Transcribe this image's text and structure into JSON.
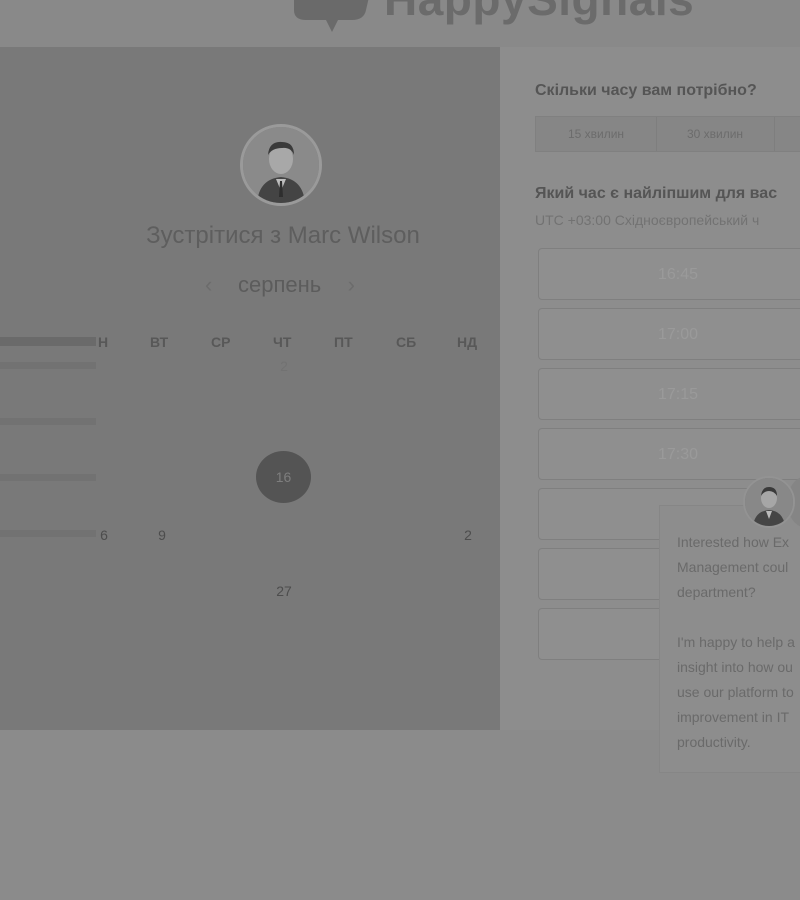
{
  "brand": {
    "logo_text": "HappySignals"
  },
  "calendar": {
    "host_title": "Зустрітися з Marc Wilson",
    "month": "серпень",
    "prev_icon": "‹",
    "next_icon": "›",
    "weekdays": [
      "Н",
      "ВТ",
      "СР",
      "ЧТ",
      "ПТ",
      "СБ",
      "НД"
    ],
    "weeks": [
      [
        "",
        "",
        "",
        "2",
        "",
        "",
        ""
      ],
      [
        "",
        "",
        "",
        "",
        "",
        "",
        ""
      ],
      [
        "",
        "",
        "",
        "16",
        "",
        "",
        ""
      ],
      [
        "6",
        "9",
        "",
        "",
        "",
        "",
        "2"
      ],
      [
        "",
        "",
        "",
        "27",
        "",
        "",
        ""
      ]
    ],
    "selected_day": "16"
  },
  "booking": {
    "duration_question": "Скільки часу вам потрібно?",
    "durations": [
      "15 хвилин",
      "30 хвилин"
    ],
    "time_question": "Який час є найліпшим для вас",
    "timezone": "UTC +03:00 Східноєвропейський ч",
    "slots": [
      "16:45",
      "17:00",
      "17:15",
      "17:30",
      "",
      "",
      ""
    ]
  },
  "chat": {
    "lines": [
      "Interested how Ex",
      "Management coul",
      "department?",
      "",
      "I'm happy to help a",
      "insight into how ou",
      "use our platform to",
      "improvement in IT",
      "productivity."
    ]
  }
}
